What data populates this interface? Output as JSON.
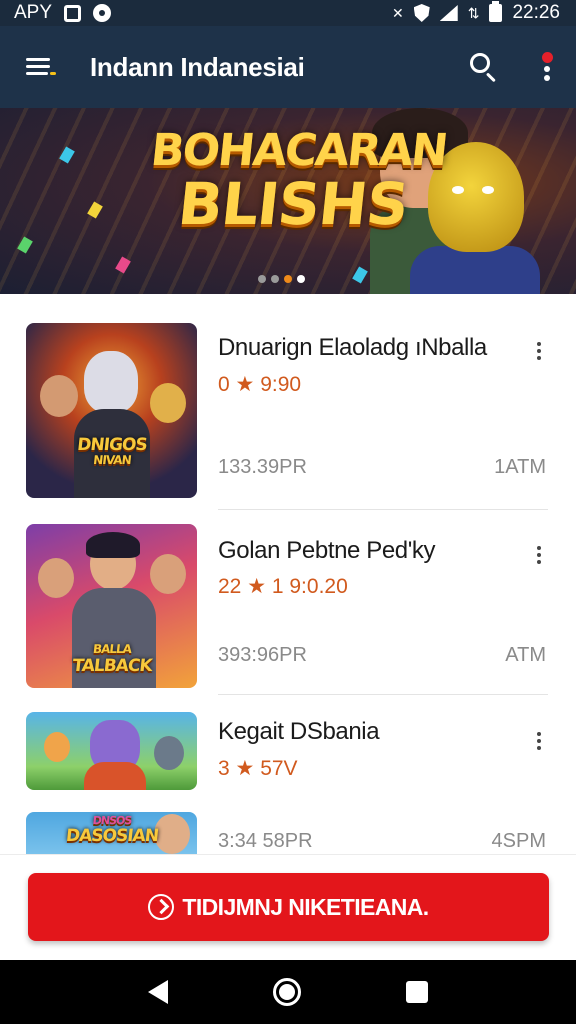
{
  "status_bar": {
    "left_text": "APY",
    "time": "22:26",
    "icons": [
      "notification-box-icon",
      "notification-circle-icon",
      "mute-icon",
      "vpn-shield-icon",
      "signal-icon",
      "data-icon",
      "battery-icon"
    ]
  },
  "app_bar": {
    "title": "Indann Indanesiai",
    "icons": [
      "menu-icon",
      "search-icon",
      "more-vert-icon"
    ],
    "badge_color": "#e5202a"
  },
  "banner": {
    "title_line1": "BOHACARAN",
    "title_line2": "BLISHS",
    "carousel_dots": 4,
    "active_dot": 4,
    "dot_colors": [
      "#9a9a9a",
      "#9a9a9a",
      "#ef8a1a",
      "#ffffff"
    ]
  },
  "items": [
    {
      "title": "Dnuarign Elaoladg ıNballa",
      "rating": "0",
      "rating_rest": "★ 9:90",
      "size": "133.39PR",
      "time": "1ATM",
      "thumb_label_1": "DNIGOS",
      "thumb_label_2": "NIVAN"
    },
    {
      "title": "Golan Pebtne Ped'ky",
      "rating": "22",
      "rating_rest": "★ 1 9:0.20",
      "size": "393:96PR",
      "time": "ATM",
      "thumb_label_1": "BALLA",
      "thumb_label_2": "TALBACK"
    },
    {
      "title": "Kegait DSbania",
      "rating": "3",
      "rating_rest": "★ 57V",
      "size": "",
      "time": ""
    },
    {
      "title": "",
      "rating": "",
      "rating_rest": "",
      "size": "3:34 58PR",
      "time": "4SPM",
      "thumb_label_1": "DNSOS",
      "thumb_label_2": "DASOSIAN"
    }
  ],
  "cta": {
    "label": "TIDIJMNJ NIKETIEANA.",
    "color": "#e3161b"
  },
  "nav_bar": {
    "icons": [
      "back-icon",
      "home-icon",
      "recents-icon"
    ]
  }
}
